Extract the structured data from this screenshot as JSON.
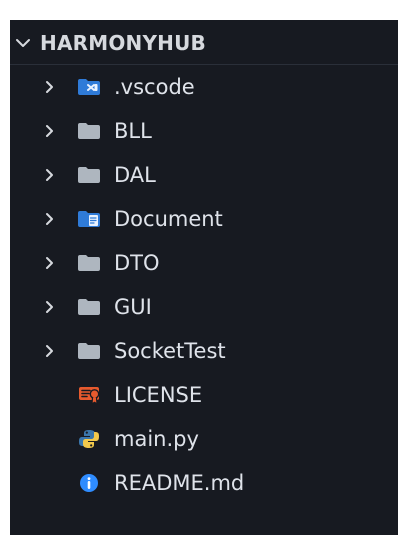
{
  "explorer": {
    "root_label": "HARMONYHUB",
    "items": [
      {
        "label": ".vscode",
        "type": "folder",
        "icon": "vscode-folder-icon",
        "expanded": false
      },
      {
        "label": "BLL",
        "type": "folder",
        "icon": "folder-icon",
        "expanded": false
      },
      {
        "label": "DAL",
        "type": "folder",
        "icon": "folder-icon",
        "expanded": false
      },
      {
        "label": "Document",
        "type": "folder",
        "icon": "document-folder-icon",
        "expanded": false
      },
      {
        "label": "DTO",
        "type": "folder",
        "icon": "folder-icon",
        "expanded": false
      },
      {
        "label": "GUI",
        "type": "folder",
        "icon": "folder-icon",
        "expanded": false
      },
      {
        "label": "SocketTest",
        "type": "folder",
        "icon": "folder-icon",
        "expanded": false
      },
      {
        "label": "LICENSE",
        "type": "file",
        "icon": "license-file-icon"
      },
      {
        "label": "main.py",
        "type": "file",
        "icon": "python-file-icon"
      },
      {
        "label": "README.md",
        "type": "file",
        "icon": "info-file-icon"
      }
    ]
  },
  "colors": {
    "panel_bg": "#171a21",
    "text": "#dfe3ea",
    "folder_gray": "#aeb6bf",
    "vscode_blue": "#2f7bd8",
    "document_blue": "#2f7bd8",
    "license_red": "#e65a2e",
    "python_blue": "#3b77ad",
    "python_yellow": "#f2c94c",
    "info_blue": "#2f8cff"
  }
}
